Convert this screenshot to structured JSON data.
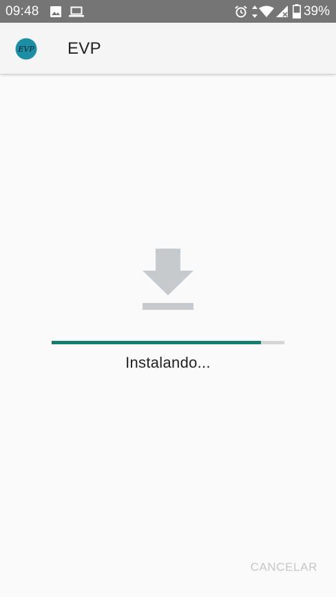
{
  "status_bar": {
    "time": "09:48",
    "battery": "39%",
    "icons": [
      "image-icon",
      "laptop-icon",
      "alarm-icon",
      "data-arrows-icon",
      "wifi-icon",
      "cell-signal-icon",
      "battery-icon"
    ]
  },
  "app_bar": {
    "logo_text": "EVP",
    "title": "EVP"
  },
  "installer": {
    "icon": "download-icon",
    "progress_fraction": 0.9,
    "status": "Instalando..."
  },
  "footer": {
    "cancel_label": "CANCELAR"
  },
  "colors": {
    "status_bar": "#757575",
    "progress": "#127c6d",
    "logo": "#1b8fa3"
  }
}
